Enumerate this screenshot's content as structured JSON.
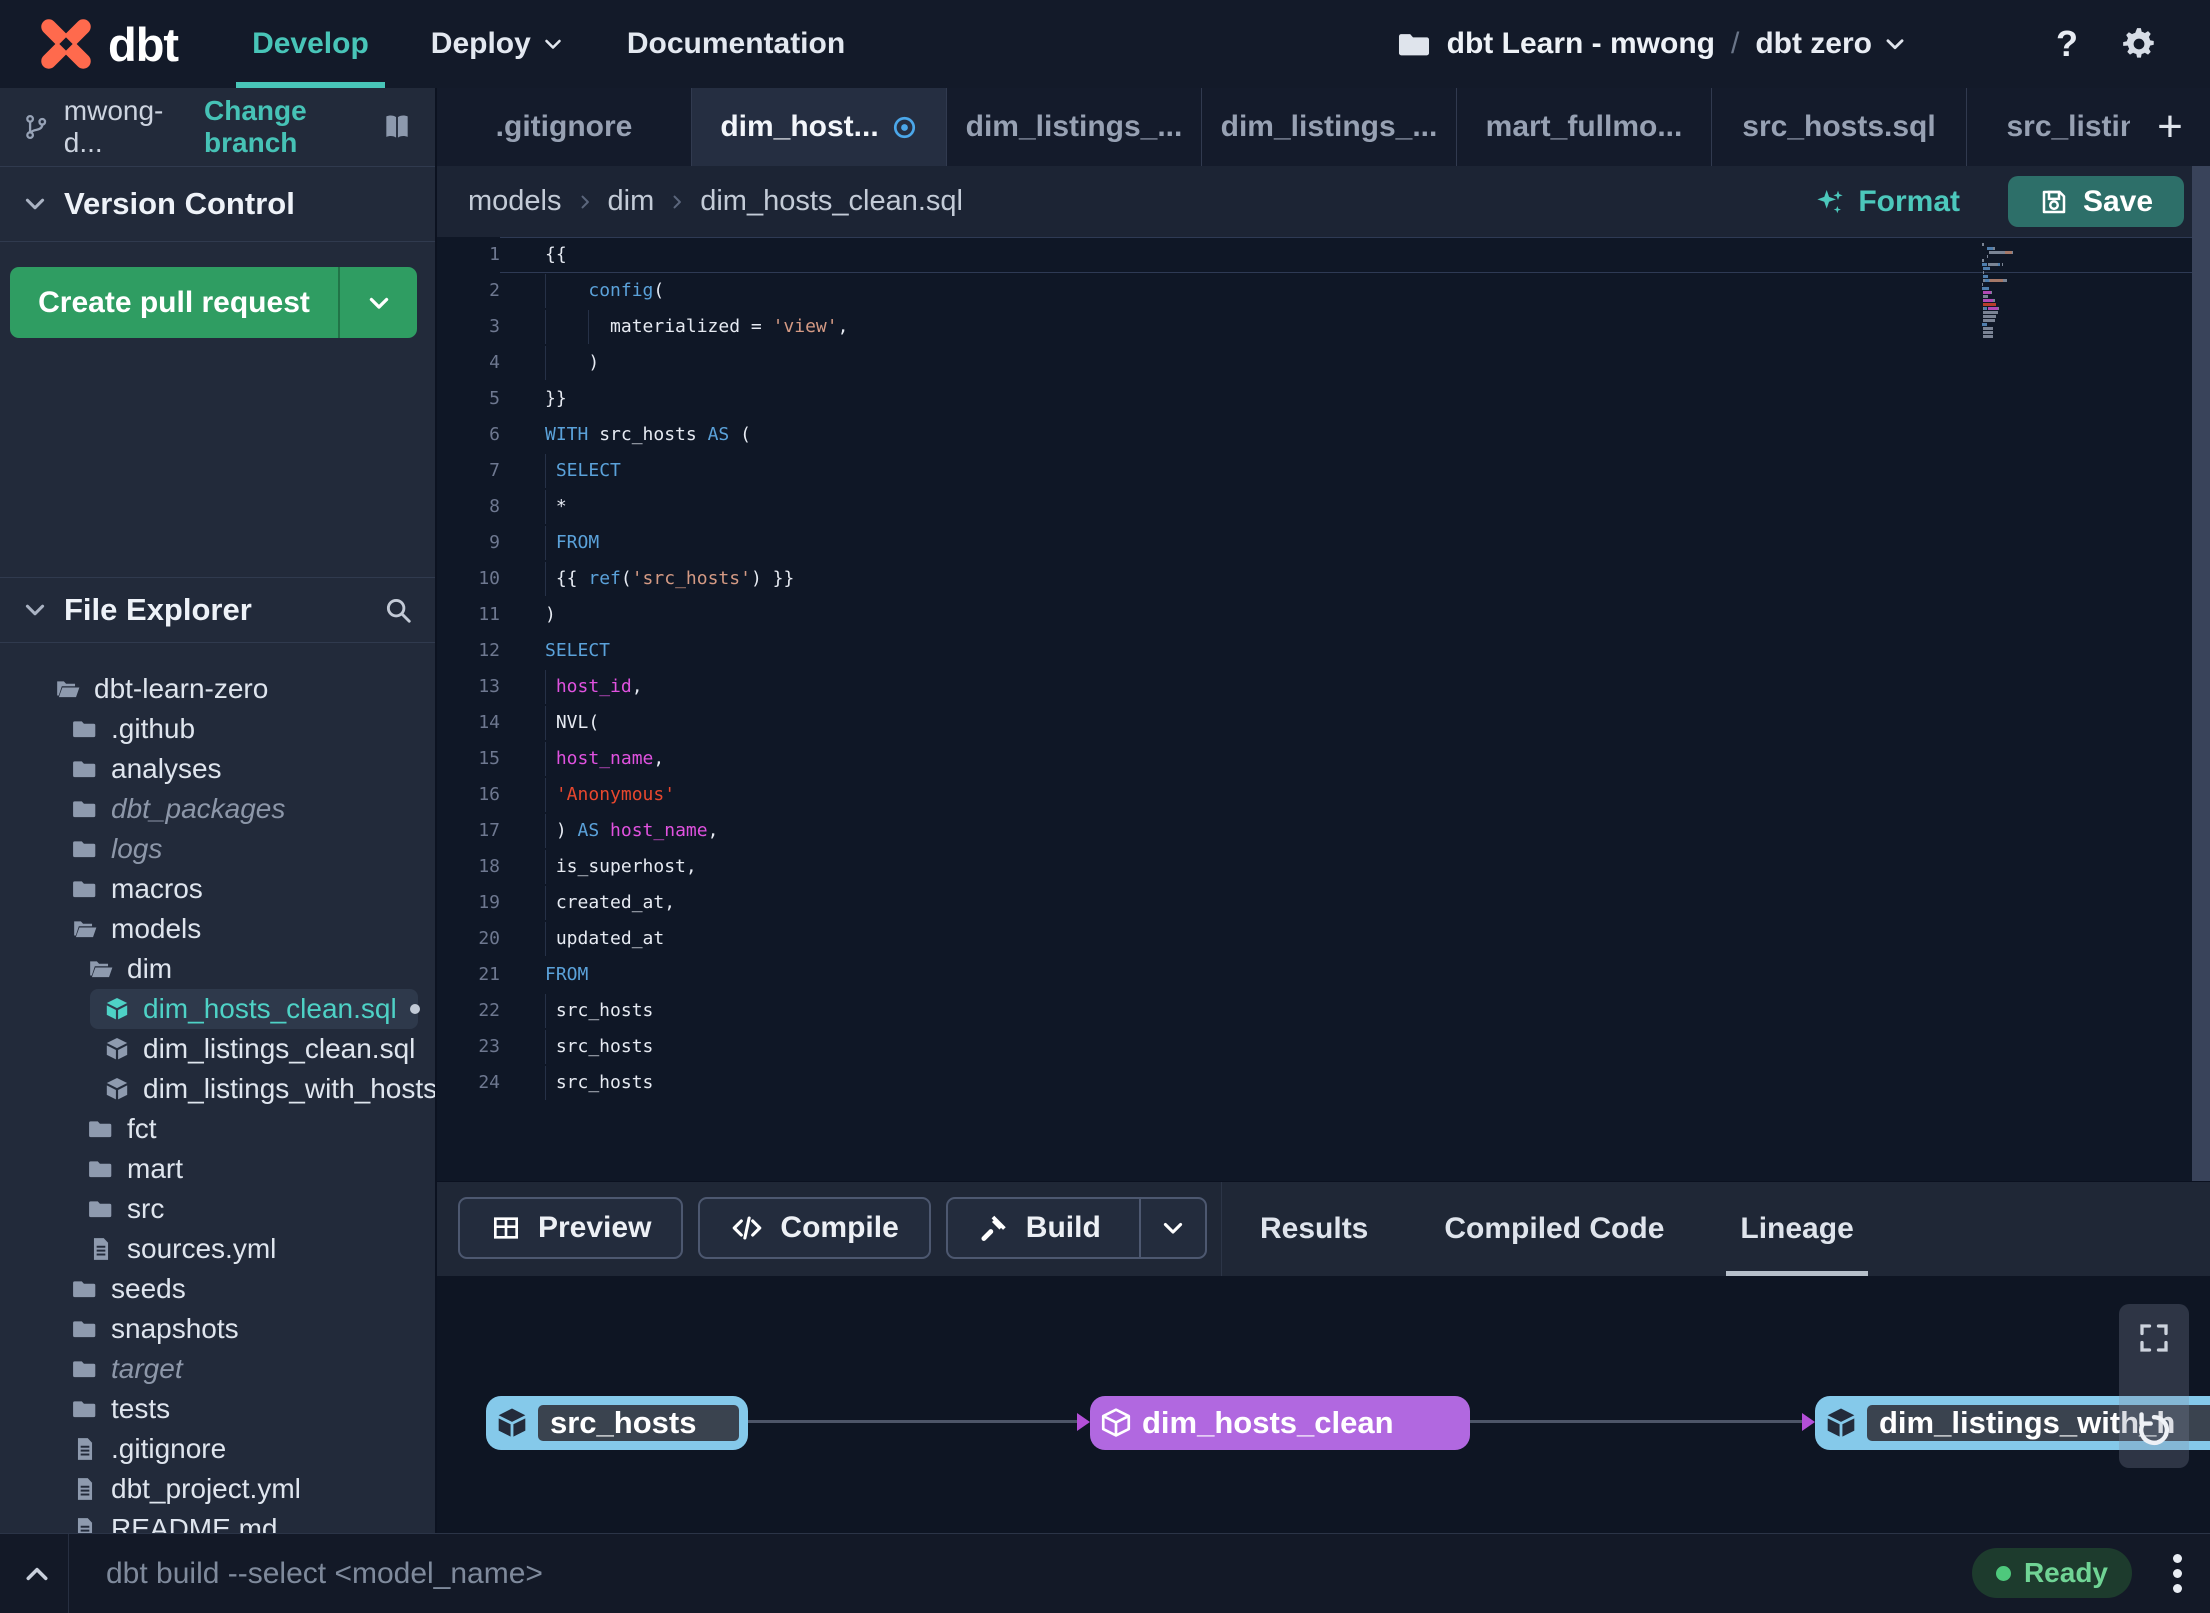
{
  "navbar": {
    "brand": "dbt",
    "menu": [
      {
        "label": "Develop",
        "active": true
      },
      {
        "label": "Deploy",
        "dropdown": true
      },
      {
        "label": "Documentation"
      }
    ],
    "project": "dbt Learn - mwong",
    "separator": "/",
    "environment": "dbt zero",
    "help_label": "?"
  },
  "sidebar": {
    "branch": {
      "name": "mwong-d...",
      "change_label": "Change branch"
    },
    "version_control": {
      "title": "Version Control",
      "create_pr_label": "Create pull request"
    },
    "file_explorer": {
      "title": "File Explorer"
    },
    "tree": [
      {
        "label": "dbt-learn-zero",
        "icon": "folder-open",
        "depth": 0
      },
      {
        "label": ".github",
        "icon": "folder",
        "depth": 1
      },
      {
        "label": "analyses",
        "icon": "folder",
        "depth": 1
      },
      {
        "label": "dbt_packages",
        "icon": "folder",
        "depth": 1,
        "italic": true
      },
      {
        "label": "logs",
        "icon": "folder",
        "depth": 1,
        "italic": true
      },
      {
        "label": "macros",
        "icon": "folder",
        "depth": 1
      },
      {
        "label": "models",
        "icon": "folder-open",
        "depth": 1
      },
      {
        "label": "dim",
        "icon": "folder-open",
        "depth": 2
      },
      {
        "label": "dim_hosts_clean.sql",
        "icon": "model",
        "depth": 3,
        "selected": true,
        "modified": true
      },
      {
        "label": "dim_listings_clean.sql",
        "icon": "model",
        "depth": 3
      },
      {
        "label": "dim_listings_with_hosts...",
        "icon": "model",
        "depth": 3
      },
      {
        "label": "fct",
        "icon": "folder",
        "depth": 2
      },
      {
        "label": "mart",
        "icon": "folder",
        "depth": 2
      },
      {
        "label": "src",
        "icon": "folder",
        "depth": 2
      },
      {
        "label": "sources.yml",
        "icon": "file",
        "depth": 2
      },
      {
        "label": "seeds",
        "icon": "folder",
        "depth": 1
      },
      {
        "label": "snapshots",
        "icon": "folder",
        "depth": 1
      },
      {
        "label": "target",
        "icon": "folder",
        "depth": 1,
        "italic": true
      },
      {
        "label": "tests",
        "icon": "folder",
        "depth": 1
      },
      {
        "label": ".gitignore",
        "icon": "file",
        "depth": 1
      },
      {
        "label": "dbt_project.yml",
        "icon": "file",
        "depth": 1
      },
      {
        "label": "README.md",
        "icon": "file",
        "depth": 1
      }
    ]
  },
  "editor": {
    "tabs": [
      {
        "label": ".gitignore"
      },
      {
        "label": "dim_host...",
        "active": true,
        "modified": true
      },
      {
        "label": "dim_listings_..."
      },
      {
        "label": "dim_listings_..."
      },
      {
        "label": "mart_fullmo..."
      },
      {
        "label": "src_hosts.sql"
      },
      {
        "label": "src_listings."
      }
    ],
    "plus_label": "+",
    "breadcrumb": [
      "models",
      "dim",
      "dim_hosts_clean.sql"
    ],
    "actions": {
      "format": "Format",
      "save": "Save"
    },
    "code_lines": [
      {
        "n": 1,
        "cur": true,
        "tokens": [
          [
            "{{",
            "w"
          ]
        ]
      },
      {
        "n": 2,
        "guides": [
          0
        ],
        "tokens": [
          [
            "    ",
            "w"
          ],
          [
            "config",
            "k"
          ],
          [
            "(",
            "w"
          ]
        ]
      },
      {
        "n": 3,
        "guides": [
          0,
          4
        ],
        "tokens": [
          [
            "      materialized = ",
            "w"
          ],
          [
            "'view'",
            "s"
          ],
          [
            ",",
            "w"
          ]
        ]
      },
      {
        "n": 4,
        "guides": [
          0
        ],
        "tokens": [
          [
            "    )",
            "w"
          ]
        ]
      },
      {
        "n": 5,
        "tokens": [
          [
            "}}",
            "w"
          ]
        ]
      },
      {
        "n": 6,
        "tokens": [
          [
            "WITH",
            "k"
          ],
          [
            " src_hosts ",
            "w"
          ],
          [
            "AS",
            "k"
          ],
          [
            " (",
            "w"
          ]
        ]
      },
      {
        "n": 7,
        "guides": [
          0
        ],
        "tokens": [
          [
            " ",
            "w"
          ],
          [
            "SELECT",
            "k"
          ]
        ]
      },
      {
        "n": 8,
        "guides": [
          0
        ],
        "tokens": [
          [
            " *",
            "w"
          ]
        ]
      },
      {
        "n": 9,
        "guides": [
          0
        ],
        "tokens": [
          [
            " ",
            "w"
          ],
          [
            "FROM",
            "k"
          ]
        ]
      },
      {
        "n": 10,
        "guides": [
          0
        ],
        "tokens": [
          [
            " {{ ",
            "w"
          ],
          [
            "ref",
            "k"
          ],
          [
            "(",
            "w"
          ],
          [
            "'src_hosts'",
            "s"
          ],
          [
            ") }}",
            "w"
          ]
        ]
      },
      {
        "n": 11,
        "tokens": [
          [
            ")",
            "w"
          ]
        ]
      },
      {
        "n": 12,
        "tokens": [
          [
            "SELECT",
            "k"
          ]
        ]
      },
      {
        "n": 13,
        "guides": [
          0
        ],
        "tokens": [
          [
            " ",
            "w"
          ],
          [
            "host_id",
            "m"
          ],
          [
            ",",
            "w"
          ]
        ]
      },
      {
        "n": 14,
        "guides": [
          0
        ],
        "tokens": [
          [
            " NVL(",
            "w"
          ]
        ]
      },
      {
        "n": 15,
        "guides": [
          0
        ],
        "tokens": [
          [
            " ",
            "w"
          ],
          [
            "host_name",
            "m"
          ],
          [
            ",",
            "w"
          ]
        ]
      },
      {
        "n": 16,
        "guides": [
          0
        ],
        "tokens": [
          [
            " ",
            "w"
          ],
          [
            "'Anonymous'",
            "r"
          ]
        ]
      },
      {
        "n": 17,
        "guides": [
          0
        ],
        "tokens": [
          [
            " ) ",
            "w"
          ],
          [
            "AS",
            "k"
          ],
          [
            " ",
            "w"
          ],
          [
            "host_name",
            "m"
          ],
          [
            ",",
            "w"
          ]
        ]
      },
      {
        "n": 18,
        "guides": [
          0
        ],
        "tokens": [
          [
            " is_superhost,",
            "w"
          ]
        ]
      },
      {
        "n": 19,
        "guides": [
          0
        ],
        "tokens": [
          [
            " created_at,",
            "w"
          ]
        ]
      },
      {
        "n": 20,
        "guides": [
          0
        ],
        "tokens": [
          [
            " updated_at",
            "w"
          ]
        ]
      },
      {
        "n": 21,
        "tokens": [
          [
            "FROM",
            "k"
          ]
        ]
      },
      {
        "n": 22,
        "guides": [
          0
        ],
        "tokens": [
          [
            " src_hosts",
            "w"
          ]
        ]
      },
      {
        "n": 23,
        "guides": [
          0
        ],
        "tokens": [
          [
            " src_hosts",
            "w"
          ]
        ]
      },
      {
        "n": 24,
        "guides": [
          0
        ],
        "tokens": [
          [
            " src_hosts",
            "w"
          ]
        ]
      }
    ]
  },
  "bottom_panel": {
    "buttons": [
      {
        "label": "Preview",
        "icon": "table"
      },
      {
        "label": "Compile",
        "icon": "code"
      },
      {
        "label": "Build",
        "icon": "hammer",
        "split": true
      }
    ],
    "tabs": [
      {
        "label": "Results"
      },
      {
        "label": "Compiled Code"
      },
      {
        "label": "Lineage",
        "active": true
      }
    ]
  },
  "lineage": {
    "nodes": [
      {
        "label": "src_hosts",
        "color": "blue"
      },
      {
        "label": "dim_hosts_clean",
        "color": "purple"
      },
      {
        "label": "dim_listings_with_h",
        "color": "blue"
      }
    ]
  },
  "status_bar": {
    "command": "dbt build --select <model_name>",
    "status": "Ready"
  },
  "colors": {
    "accent_teal": "#48c5b8",
    "green_button": "#2f9d62",
    "save_button": "#2d6f69",
    "node_blue": "#85c9ea",
    "node_purple": "#b168e0",
    "arrow_purple": "#b44fd8",
    "status_green": "#70d495",
    "code_keyword": "#5ba2da",
    "code_string": "#d49a84",
    "code_red": "#e8472e",
    "code_magenta": "#e052df"
  }
}
